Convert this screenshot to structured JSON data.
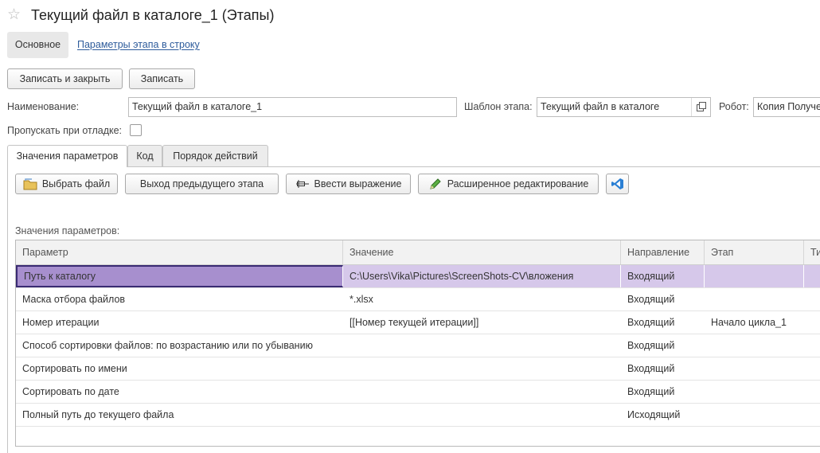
{
  "window": {
    "title": "Текущий файл в каталоге_1 (Этапы)",
    "favorite_icon": "star-icon"
  },
  "nav": {
    "main": "Основное",
    "link": "Параметры этапа в строку"
  },
  "commands": {
    "save_close": "Записать и закрыть",
    "save": "Записать"
  },
  "form": {
    "name_label": "Наименование:",
    "name_value": "Текущий файл в каталоге_1",
    "template_label": "Шаблон этапа:",
    "template_value": "Текущий файл в каталоге",
    "robot_label": "Робот:",
    "robot_value": "Копия Получе",
    "skip_label": "Пропускать при отладке:",
    "skip_checked": false
  },
  "tabs": [
    {
      "label": "Значения параметров",
      "active": true
    },
    {
      "label": "Код",
      "active": false
    },
    {
      "label": "Порядок действий",
      "active": false
    }
  ],
  "toolbar": {
    "choose_file": "Выбрать файл",
    "prev_output": "Выход предыдущего этапа",
    "enter_expression": "Ввести выражение",
    "advanced_edit": "Расширенное редактирование"
  },
  "grid": {
    "caption": "Значения параметров:",
    "columns": [
      "Параметр",
      "Значение",
      "Направление",
      "Этап",
      "Ти"
    ],
    "rows": [
      [
        "Путь к каталогу",
        "C:\\Users\\Vika\\Pictures\\ScreenShots-CV\\вложения",
        "Входящий",
        "",
        ""
      ],
      [
        "Маска отбора файлов",
        "*.xlsx",
        "Входящий",
        "",
        ""
      ],
      [
        "Номер итерации",
        "[[Номер текущей итерации]]",
        "Входящий",
        "Начало цикла_1",
        ""
      ],
      [
        "Способ сортировки файлов: по возрастанию или по убыванию",
        "",
        "Входящий",
        "",
        ""
      ],
      [
        "Сортировать по имени",
        "",
        "Входящий",
        "",
        ""
      ],
      [
        "Сортировать по дате",
        "",
        "Входящий",
        "",
        ""
      ],
      [
        "Полный путь до текущего файла",
        "",
        "Исходящий",
        "",
        ""
      ]
    ],
    "selected_row": 0
  },
  "colors": {
    "selection": "#a78fce",
    "selection_row": "#d6c8ea",
    "link": "#2d5b9b"
  }
}
